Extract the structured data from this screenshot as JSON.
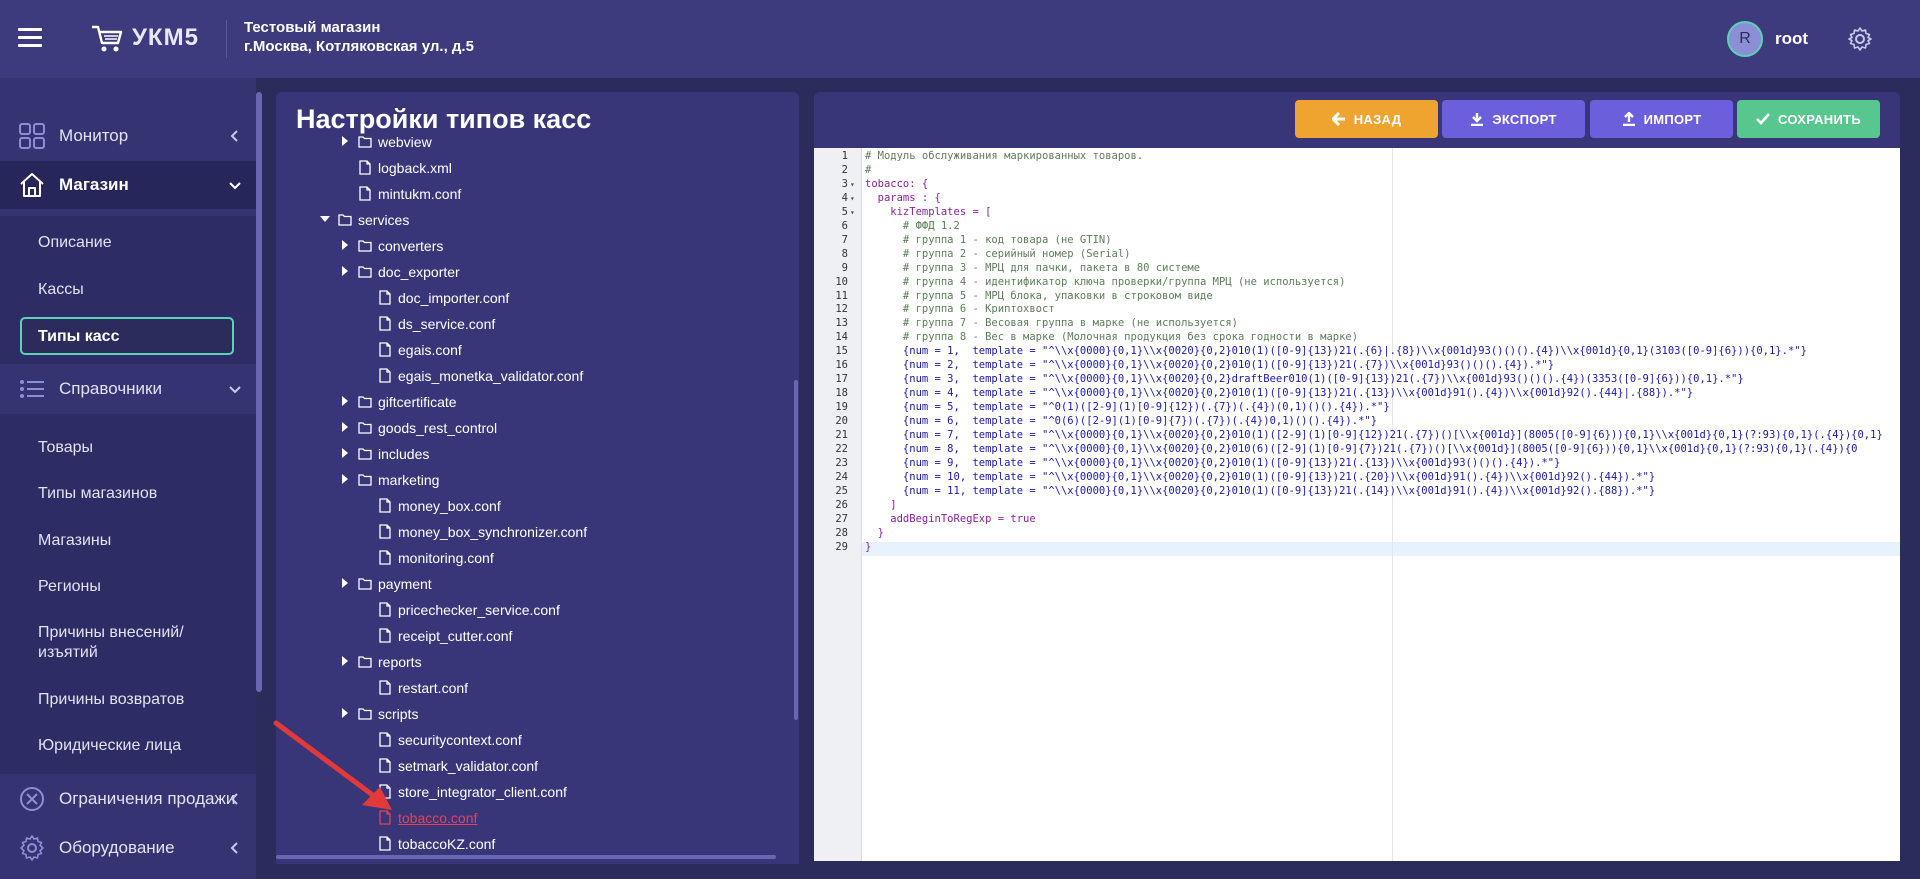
{
  "header": {
    "app_name": "УКМ5",
    "store_name": "Тестовый магазин",
    "store_address": "г.Москва, Котляковская ул., д.5",
    "avatar_letter": "R",
    "username": "root"
  },
  "sidebar": {
    "monitor": "Монитор",
    "shop": "Магазин",
    "shop_items": [
      "Описание",
      "Кассы"
    ],
    "active_item": "Типы касс",
    "directories": "Справочники",
    "dir_items": [
      "Товары",
      "Типы магазинов",
      "Магазины",
      "Регионы",
      "Причины внесений/",
      "изъятий",
      "Причины возвратов",
      "Юридические лица"
    ],
    "restrictions": "Ограничения продажи",
    "equipment": "Оборудование"
  },
  "page": {
    "title": "Настройки типов касс"
  },
  "tree": [
    {
      "label": "webview",
      "type": "folder",
      "indent": 2,
      "collapsed": true
    },
    {
      "label": "logback.xml",
      "type": "file",
      "indent": 2
    },
    {
      "label": "mintukm.conf",
      "type": "file",
      "indent": 2
    },
    {
      "label": "services",
      "type": "folder",
      "indent": 1,
      "expanded": true
    },
    {
      "label": "converters",
      "type": "folder",
      "indent": 2,
      "collapsed": true
    },
    {
      "label": "doc_exporter",
      "type": "folder",
      "indent": 2,
      "collapsed": true
    },
    {
      "label": "doc_importer.conf",
      "type": "file",
      "indent": 3
    },
    {
      "label": "ds_service.conf",
      "type": "file",
      "indent": 3
    },
    {
      "label": "egais.conf",
      "type": "file",
      "indent": 3
    },
    {
      "label": "egais_monetka_validator.conf",
      "type": "file",
      "indent": 3
    },
    {
      "label": "giftcertificate",
      "type": "folder",
      "indent": 2,
      "collapsed": true
    },
    {
      "label": "goods_rest_control",
      "type": "folder",
      "indent": 2,
      "collapsed": true
    },
    {
      "label": "includes",
      "type": "folder",
      "indent": 2,
      "collapsed": true
    },
    {
      "label": "marketing",
      "type": "folder",
      "indent": 2,
      "collapsed": true
    },
    {
      "label": "money_box.conf",
      "type": "file",
      "indent": 3
    },
    {
      "label": "money_box_synchronizer.conf",
      "type": "file",
      "indent": 3
    },
    {
      "label": "monitoring.conf",
      "type": "file",
      "indent": 3
    },
    {
      "label": "payment",
      "type": "folder",
      "indent": 2,
      "collapsed": true
    },
    {
      "label": "pricechecker_service.conf",
      "type": "file",
      "indent": 3
    },
    {
      "label": "receipt_cutter.conf",
      "type": "file",
      "indent": 3
    },
    {
      "label": "reports",
      "type": "folder",
      "indent": 2,
      "collapsed": true
    },
    {
      "label": "restart.conf",
      "type": "file",
      "indent": 3
    },
    {
      "label": "scripts",
      "type": "folder",
      "indent": 2,
      "collapsed": true
    },
    {
      "label": "securitycontext.conf",
      "type": "file",
      "indent": 3
    },
    {
      "label": "setmark_validator.conf",
      "type": "file",
      "indent": 3
    },
    {
      "label": "store_integrator_client.conf",
      "type": "file",
      "indent": 3
    },
    {
      "label": "tobacco.conf",
      "type": "file",
      "indent": 3,
      "selected": true
    },
    {
      "label": "tobaccoKZ.conf",
      "type": "file",
      "indent": 3
    }
  ],
  "toolbar": {
    "back": "НАЗАД",
    "export": "ЭКСПОРТ",
    "import": "ИМПОРТ",
    "save": "СОХРАНИТЬ"
  },
  "editor": {
    "lines": [
      {
        "n": "1",
        "text": "# Модуль обслуживания маркированных товаров.",
        "kind": "com"
      },
      {
        "n": "2",
        "text": "#",
        "kind": "com"
      },
      {
        "n": "3",
        "text": "tobacco: {",
        "kind": "key",
        "fold": true
      },
      {
        "n": "4",
        "text": "  params : {",
        "kind": "key",
        "fold": true
      },
      {
        "n": "5",
        "text": "    kizTemplates = [",
        "kind": "key",
        "fold": true
      },
      {
        "n": "6",
        "text": "      # ФФД 1.2",
        "kind": "com"
      },
      {
        "n": "7",
        "text": "      # группа 1 - код товара (не GTIN)",
        "kind": "com"
      },
      {
        "n": "8",
        "text": "      # группа 2 - серийный номер (Serial)",
        "kind": "com"
      },
      {
        "n": "9",
        "text": "      # группа 3 - МРЦ для пачки, пакета в 80 системе",
        "kind": "com"
      },
      {
        "n": "10",
        "text": "      # группа 4 - идентификатор ключа проверки/группа МРЦ (не используется)",
        "kind": "com"
      },
      {
        "n": "11",
        "text": "      # группа 5 - МРЦ блока, упаковки в строковом виде",
        "kind": "com"
      },
      {
        "n": "12",
        "text": "      # группа 6 - Криптохвост",
        "kind": "com"
      },
      {
        "n": "13",
        "text": "      # группа 7 - Весовая группа в марке (не используется)",
        "kind": "com"
      },
      {
        "n": "14",
        "text": "      # группа 8 - Вес в марке (Молочная продукция без срока годности в марке)",
        "kind": "com"
      },
      {
        "n": "15",
        "text": "      {num = 1,  template = \"^\\\\x{0000}{0,1}\\\\x{0020}{0,2}010(1)([0-9]{13})21(.{6}|.{8})\\\\x{001d}93()()().{4})\\\\x{001d}{0,1}(3103([0-9]{6})){0,1}.*\"}",
        "kind": "str"
      },
      {
        "n": "16",
        "text": "      {num = 2,  template = \"^\\\\x{0000}{0,1}\\\\x{0020}{0,2}010(1)([0-9]{13})21(.{7})\\\\x{001d}93()()().{4}).*\"}",
        "kind": "str"
      },
      {
        "n": "17",
        "text": "      {num = 3,  template = \"^\\\\x{0000}{0,1}\\\\x{0020}{0,2}draftBeer010(1)([0-9]{13})21(.{7})\\\\x{001d}93()()().{4})(3353([0-9]{6})){0,1}.*\"}",
        "kind": "str"
      },
      {
        "n": "18",
        "text": "      {num = 4,  template = \"^\\\\x{0000}{0,1}\\\\x{0020}{0,2}010(1)([0-9]{13})21(.{13})\\\\x{001d}91().{4})\\\\x{001d}92().{44}|.{88}).*\"}",
        "kind": "str"
      },
      {
        "n": "19",
        "text": "      {num = 5,  template = \"^0(1)([2-9](1)[0-9]{12})(.{7})(.{4})(0,1)()().{4}).*\"}",
        "kind": "str"
      },
      {
        "n": "20",
        "text": "      {num = 6,  template = \"^0(6)([2-9](1)[0-9]{7})(.{7})(.{4})0,1)()().{4}).*\"}",
        "kind": "str"
      },
      {
        "n": "21",
        "text": "      {num = 7,  template = \"^\\\\x{0000}{0,1}\\\\x{0020}{0,2}010(1)([2-9](1)[0-9]{12})21(.{7})()[\\\\x{001d}](8005([0-9]{6})){0,1}\\\\x{001d}{0,1}(?:93){0,1}(.{4}){0,1}",
        "kind": "str"
      },
      {
        "n": "22",
        "text": "      {num = 8,  template = \"^\\\\x{0000}{0,1}\\\\x{0020}{0,2}010(6)([2-9](1)[0-9]{7})21(.{7})()[\\\\x{001d}](8005([0-9]{6})){0,1}\\\\x{001d}{0,1}(?:93){0,1}(.{4}){0",
        "kind": "str"
      },
      {
        "n": "23",
        "text": "      {num = 9,  template = \"^\\\\x{0000}{0,1}\\\\x{0020}{0,2}010(1)([0-9]{13})21(.{13})\\\\x{001d}93()()().{4}).*\"}",
        "kind": "str"
      },
      {
        "n": "24",
        "text": "      {num = 10, template = \"^\\\\x{0000}{0,1}\\\\x{0020}{0,2}010(1)([0-9]{13})21(.{20})\\\\x{001d}91().{4})\\\\x{001d}92().{44}).*\"}",
        "kind": "str"
      },
      {
        "n": "25",
        "text": "      {num = 11, template = \"^\\\\x{0000}{0,1}\\\\x{0020}{0,2}010(1)([0-9]{13})21(.{14})\\\\x{001d}91().{4})\\\\x{001d}92().{88}).*\"}",
        "kind": "str"
      },
      {
        "n": "26",
        "text": "    ]",
        "kind": "key"
      },
      {
        "n": "27",
        "text": "    addBeginToRegExp = true",
        "kind": "key"
      },
      {
        "n": "28",
        "text": "  }",
        "kind": "key"
      },
      {
        "n": "29",
        "text": "}",
        "kind": "key"
      }
    ]
  },
  "colors": {
    "header_bg": "#3e3a7e",
    "sidebar_bg": "#353372",
    "accent_green": "#5ad3b5",
    "back_btn": "#f0a430",
    "action_btn": "#6b5fdc",
    "save_btn": "#58c78f",
    "selected_file": "#e0435c"
  }
}
